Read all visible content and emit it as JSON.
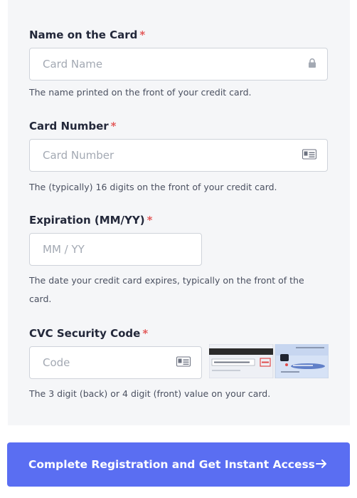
{
  "form": {
    "name": {
      "label": "Name on the Card",
      "required_mark": "*",
      "placeholder": "Card Name",
      "value": "",
      "help": "The name printed on the front of your credit card."
    },
    "number": {
      "label": "Card Number",
      "required_mark": "*",
      "placeholder": "Card Number",
      "value": "",
      "help": "The (typically) 16 digits on the front of your credit card."
    },
    "expiration": {
      "label": "Expiration (MM/YY)",
      "required_mark": "*",
      "placeholder": "MM / YY",
      "value": "",
      "help": "The date your credit card expires, typically on the front of the card."
    },
    "cvc": {
      "label": "CVC Security Code",
      "required_mark": "*",
      "placeholder": "Code",
      "value": "",
      "help": "The 3 digit (back) or 4 digit (front) value on your card."
    }
  },
  "submit": {
    "label": "Complete Registration and Get Instant Access",
    "icon": "arrow-right-icon"
  },
  "colors": {
    "panel_bg": "#f5f6f8",
    "required": "#e35b5b",
    "button": "#5a6ef2"
  }
}
